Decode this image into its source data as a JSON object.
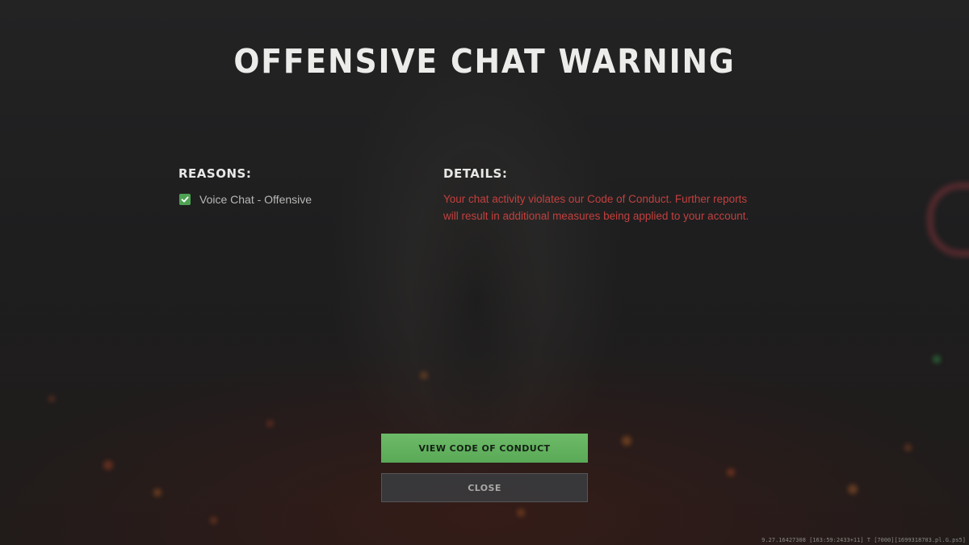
{
  "title": "OFFENSIVE CHAT WARNING",
  "reasons": {
    "heading": "REASONS:",
    "items": [
      {
        "label": "Voice Chat - Offensive",
        "checked": true
      }
    ]
  },
  "details": {
    "heading": "DETAILS:",
    "text": "Your chat activity violates our Code of Conduct. Further reports will result in additional measures being applied to your account."
  },
  "buttons": {
    "view_code": "VIEW CODE OF CONDUCT",
    "close": "CLOSE"
  },
  "build_info": "9.27.16427308 [163:59:2433+11] T [7000][1699318703.pl.G.ps5]",
  "colors": {
    "background": "#1e1e1f",
    "details_text": "#c2403e",
    "primary_button": "#5fb05c",
    "checkbox": "#4ea353"
  }
}
